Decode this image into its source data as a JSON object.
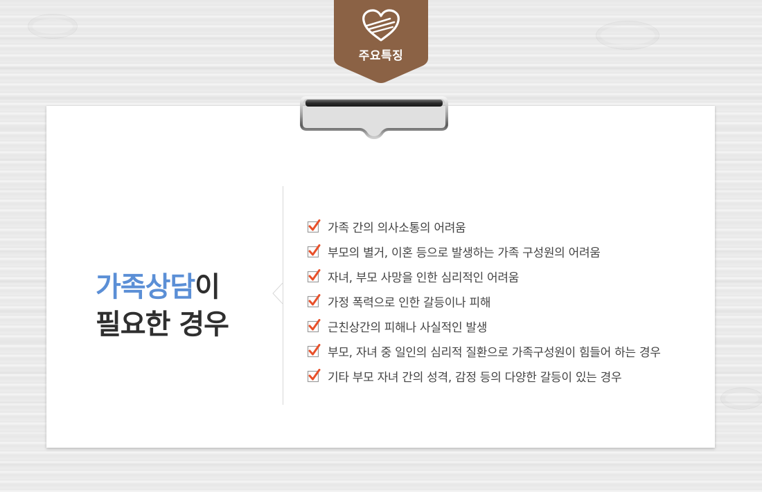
{
  "badge": {
    "label": "주요특징",
    "icon": "heart-bandage-icon",
    "color": "#8b6245"
  },
  "heading": {
    "accent_text": "가족상담",
    "line1_rest": "이",
    "line2": "필요한 경우",
    "accent_color": "#5b8fd6"
  },
  "check_icon": "checkbox-checked-icon",
  "check_color": "#e8502a",
  "items": [
    "가족 간의 의사소통의 어려움",
    "부모의 별거, 이혼 등으로 발생하는 가족 구성원의 어려움",
    "자녀, 부모 사망을 인한 심리적인 어려움",
    "가정 폭력으로 인한 갈등이나 피해",
    "근친상간의 피해나 사실적인 발생",
    "부모, 자녀 중 일인의 심리적 질환으로 가족구성원이 힘들어 하는 경우",
    "기타 부모 자녀 간의 성격, 감정 등의 다양한 갈등이 있는 경우"
  ]
}
